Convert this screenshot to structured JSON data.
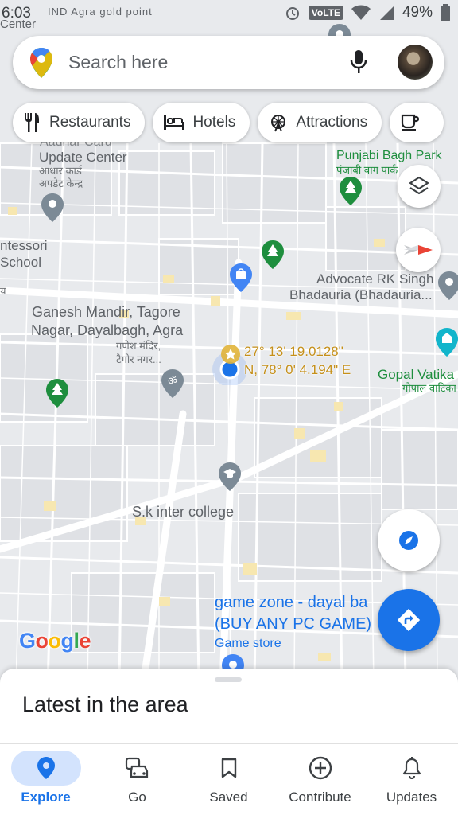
{
  "status_bar": {
    "time": "6:03",
    "notification_text": "IND  Agra gold point",
    "volte": "VoLTE",
    "battery": "49%",
    "corner_text": "Center"
  },
  "search": {
    "placeholder": "Search here"
  },
  "chips": [
    {
      "label": "Restaurants",
      "icon": "fork-knife-icon"
    },
    {
      "label": "Hotels",
      "icon": "bed-icon"
    },
    {
      "label": "Attractions",
      "icon": "ferris-wheel-icon"
    },
    {
      "label": "",
      "icon": "coffee-cup-icon"
    }
  ],
  "map_labels": {
    "aadhar_top": "Aadhar Card",
    "aadhar": "Update Center",
    "aadhar_hi1": "आधार कार्ड",
    "aadhar_hi2": "अपडेट केन्द्र",
    "punjabi": "Punjabi Bagh Park",
    "punjabi_hi": "पंजाबी बाग पार्क",
    "montessori1": "ntessori",
    "montessori2": "School",
    "advocate1": "Advocate RK Singh",
    "advocate2": "Bhadauria (Bhadauria...",
    "ganesh1": "Ganesh Mandir, Tagore",
    "ganesh2": "Nagar, Dayalbagh, Agra",
    "ganesh_hi1": "गणेश मंदिर,",
    "ganesh_hi2": "टैगोर नगर...",
    "coord1": "27° 13' 19.0128\"",
    "coord2": "N, 78° 0' 4.194\" E",
    "gopal": "Gopal Vatika",
    "gopal_hi": "गोपाल वाटिका",
    "sk": "S.k inter college",
    "game1": "game zone - dayal ba",
    "game2": "(BUY ANY PC GAME)",
    "game3": "Game store",
    "left_cut": "य"
  },
  "google_logo": {
    "letters": [
      "G",
      "o",
      "o",
      "g",
      "l",
      "e"
    ],
    "colors": [
      "#4285F4",
      "#EA4335",
      "#FBBC05",
      "#4285F4",
      "#34A853",
      "#EA4335"
    ]
  },
  "sheet": {
    "title": "Latest in the area"
  },
  "nav": [
    {
      "label": "Explore",
      "icon": "location-pin-icon",
      "active": true
    },
    {
      "label": "Go",
      "icon": "car-icon",
      "active": false
    },
    {
      "label": "Saved",
      "icon": "bookmark-icon",
      "active": false
    },
    {
      "label": "Contribute",
      "icon": "add-circle-icon",
      "active": false
    },
    {
      "label": "Updates",
      "icon": "bell-icon",
      "active": false
    }
  ],
  "colors": {
    "accent": "#1a73e8",
    "park_green": "#1e8e3e",
    "coord_gold": "#c5901a"
  }
}
